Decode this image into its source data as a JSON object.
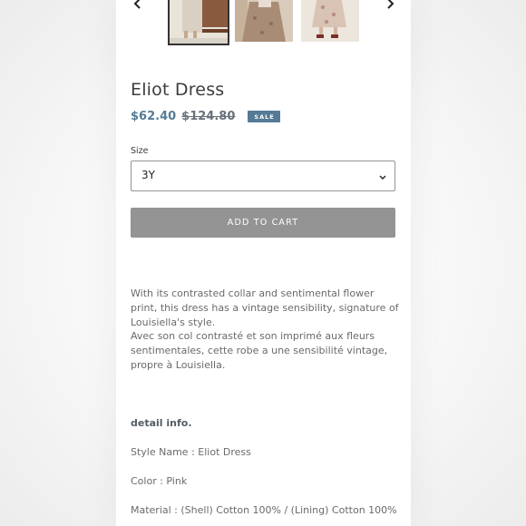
{
  "gallery": {
    "prev_icon": "chevron-left-icon",
    "next_icon": "chevron-right-icon",
    "thumbnails": [
      {
        "alt": "Eliot Dress photo 1",
        "selected": true
      },
      {
        "alt": "Eliot Dress photo 2",
        "selected": false
      },
      {
        "alt": "Eliot Dress photo 3",
        "selected": false
      }
    ]
  },
  "product": {
    "title": "Eliot Dress",
    "sale_price": "$62.40",
    "original_price": "$124.80",
    "badge": "SALE"
  },
  "options": {
    "size_label": "Size",
    "size_value": "3Y"
  },
  "cart": {
    "button_label": "ADD TO CART"
  },
  "description": {
    "english": "With its contrasted collar and sentimental flower print, this dress has a vintage sensibility, signature of Louisiella's style.",
    "french": "Avec son col contrasté et son imprimé aux fleurs sentimentales, cette robe a une sensibilité vintage, propre à Louisiella."
  },
  "details": {
    "heading": "detail info.",
    "style_name": "Style Name : Eliot Dress",
    "color": "Color : Pink",
    "material": "Material : (Shell) Cotton 100% / (Lining) Cotton 100%"
  },
  "colors": {
    "accent": "#557b97",
    "button_disabled": "#949494",
    "text": "#3a3a3a"
  }
}
